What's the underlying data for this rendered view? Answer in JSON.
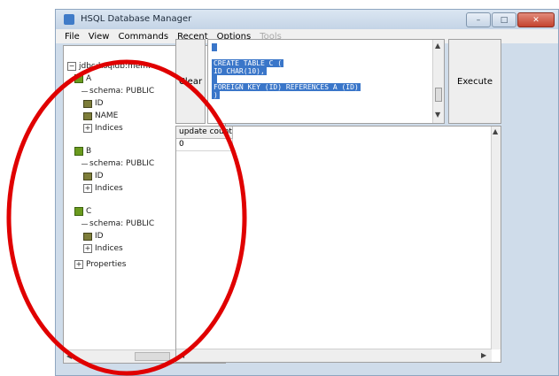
{
  "window": {
    "title": "HSQL Database Manager",
    "buttons": {
      "minimize": "–",
      "maximize": "□",
      "close": "✕"
    }
  },
  "menu": {
    "items": [
      {
        "label": "File",
        "enabled": true
      },
      {
        "label": "View",
        "enabled": true
      },
      {
        "label": "Commands",
        "enabled": true
      },
      {
        "label": "Recent",
        "enabled": true
      },
      {
        "label": "Options",
        "enabled": true
      },
      {
        "label": "Tools",
        "enabled": false
      }
    ]
  },
  "tree": {
    "root": "jdbc:hsqldb:mem:",
    "tables": [
      {
        "name": "A",
        "schema": "schema: PUBLIC",
        "columns": [
          "ID",
          "NAME"
        ],
        "indices": "Indices"
      },
      {
        "name": "B",
        "schema": "schema: PUBLIC",
        "columns": [
          "ID"
        ],
        "indices": "Indices"
      },
      {
        "name": "C",
        "schema": "schema: PUBLIC",
        "columns": [
          "ID"
        ],
        "indices": "Indices"
      }
    ],
    "properties": "Properties"
  },
  "sql": {
    "lines": [
      "",
      "CREATE TABLE C (",
      "ID CHAR(10),",
      "",
      "FOREIGN KEY (ID) REFERENCES A (ID)",
      ")"
    ]
  },
  "buttons": {
    "clear": "Clear",
    "execute": "Execute"
  },
  "results": {
    "header": "update count",
    "rows": [
      "0"
    ]
  },
  "colors": {
    "selection": "#3a76c9",
    "annotation": "#e00000"
  }
}
